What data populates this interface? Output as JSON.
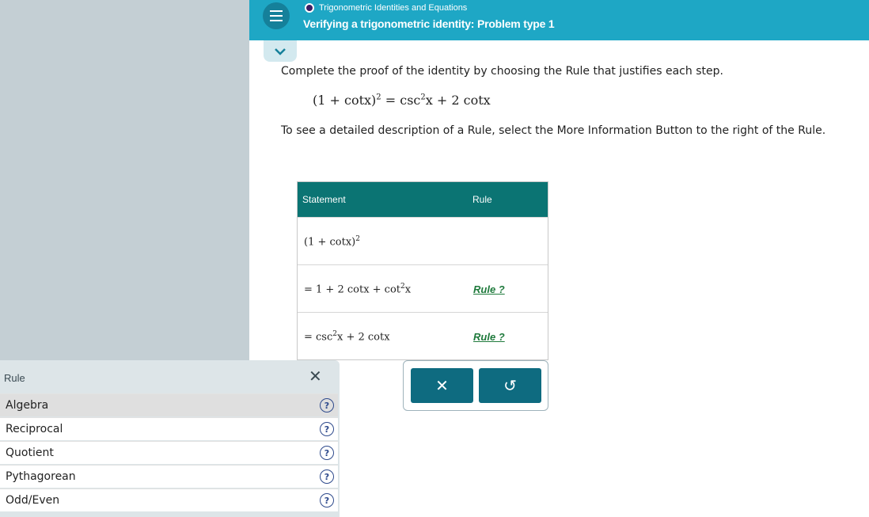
{
  "header": {
    "topic": "Trigonometric Identities and Equations",
    "title": "Verifying a trigonometric identity: Problem type 1"
  },
  "instructions": {
    "line1": "Complete the proof of the identity by choosing the Rule that justifies each step.",
    "line2": "To see a detailed description of a Rule, select the More Information Button to the right of the Rule."
  },
  "identity": {
    "lhs": "(1 + cotx)",
    "lhs_exp": "2",
    "eq": " = csc",
    "csc_exp": "2",
    "rhs_tail": "x + 2 cotx"
  },
  "proof_table": {
    "header_statement": "Statement",
    "header_rule": "Rule",
    "rows": [
      {
        "stmt_a": "(1 + cotx)",
        "exp": "2",
        "stmt_b": "",
        "rule": ""
      },
      {
        "stmt_a": "= 1 + 2 cotx + cot",
        "exp": "2",
        "stmt_b": "x",
        "rule": "Rule ?"
      },
      {
        "stmt_a": "= csc",
        "exp": "2",
        "stmt_b": "x + 2 cotx",
        "rule": "Rule ?"
      }
    ]
  },
  "actions": {
    "clear_symbol": "✕",
    "undo_symbol": "↺"
  },
  "rule_panel": {
    "title": "Rule",
    "close_symbol": "✕",
    "items": [
      {
        "label": "Algebra",
        "info": "?"
      },
      {
        "label": "Reciprocal",
        "info": "?"
      },
      {
        "label": "Quotient",
        "info": "?"
      },
      {
        "label": "Pythagorean",
        "info": "?"
      },
      {
        "label": "Odd/Even",
        "info": "?"
      }
    ]
  },
  "colors": {
    "topbar": "#1ea7c5",
    "table_header": "#0b7473",
    "action_button": "#0e6b80",
    "rule_link": "#1f7a3c"
  },
  "icons": [
    "hamburger-menu-icon",
    "topic-dot-icon",
    "chevron-down-icon",
    "close-icon",
    "undo-icon",
    "help-icon"
  ]
}
